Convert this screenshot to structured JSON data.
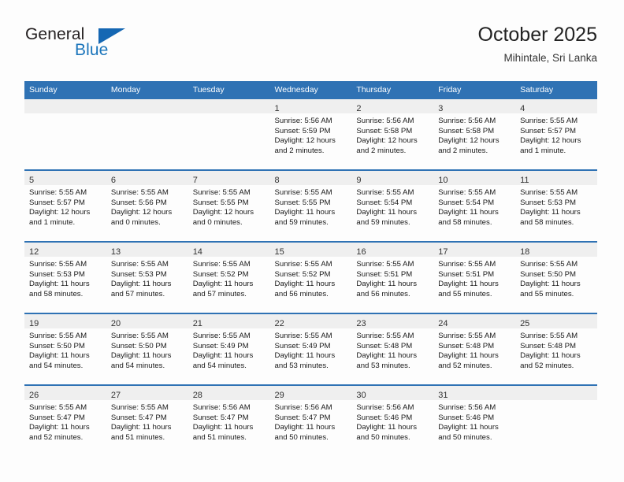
{
  "brand": {
    "name_part1": "General",
    "name_part2": "Blue",
    "accent_color": "#1b75bb",
    "triangle_color": "#1567b3"
  },
  "header": {
    "title": "October 2025",
    "subtitle": "Mihintale, Sri Lanka"
  },
  "calendar": {
    "header_bg": "#2f72b4",
    "daynum_bg": "#efefef",
    "weekdays": [
      "Sunday",
      "Monday",
      "Tuesday",
      "Wednesday",
      "Thursday",
      "Friday",
      "Saturday"
    ],
    "weeks": [
      [
        {
          "day": "",
          "empty": true
        },
        {
          "day": "",
          "empty": true
        },
        {
          "day": "",
          "empty": true
        },
        {
          "day": "1",
          "sunrise": "Sunrise: 5:56 AM",
          "sunset": "Sunset: 5:59 PM",
          "daylight1": "Daylight: 12 hours",
          "daylight2": "and 2 minutes."
        },
        {
          "day": "2",
          "sunrise": "Sunrise: 5:56 AM",
          "sunset": "Sunset: 5:58 PM",
          "daylight1": "Daylight: 12 hours",
          "daylight2": "and 2 minutes."
        },
        {
          "day": "3",
          "sunrise": "Sunrise: 5:56 AM",
          "sunset": "Sunset: 5:58 PM",
          "daylight1": "Daylight: 12 hours",
          "daylight2": "and 2 minutes."
        },
        {
          "day": "4",
          "sunrise": "Sunrise: 5:55 AM",
          "sunset": "Sunset: 5:57 PM",
          "daylight1": "Daylight: 12 hours",
          "daylight2": "and 1 minute."
        }
      ],
      [
        {
          "day": "5",
          "sunrise": "Sunrise: 5:55 AM",
          "sunset": "Sunset: 5:57 PM",
          "daylight1": "Daylight: 12 hours",
          "daylight2": "and 1 minute."
        },
        {
          "day": "6",
          "sunrise": "Sunrise: 5:55 AM",
          "sunset": "Sunset: 5:56 PM",
          "daylight1": "Daylight: 12 hours",
          "daylight2": "and 0 minutes."
        },
        {
          "day": "7",
          "sunrise": "Sunrise: 5:55 AM",
          "sunset": "Sunset: 5:55 PM",
          "daylight1": "Daylight: 12 hours",
          "daylight2": "and 0 minutes."
        },
        {
          "day": "8",
          "sunrise": "Sunrise: 5:55 AM",
          "sunset": "Sunset: 5:55 PM",
          "daylight1": "Daylight: 11 hours",
          "daylight2": "and 59 minutes."
        },
        {
          "day": "9",
          "sunrise": "Sunrise: 5:55 AM",
          "sunset": "Sunset: 5:54 PM",
          "daylight1": "Daylight: 11 hours",
          "daylight2": "and 59 minutes."
        },
        {
          "day": "10",
          "sunrise": "Sunrise: 5:55 AM",
          "sunset": "Sunset: 5:54 PM",
          "daylight1": "Daylight: 11 hours",
          "daylight2": "and 58 minutes."
        },
        {
          "day": "11",
          "sunrise": "Sunrise: 5:55 AM",
          "sunset": "Sunset: 5:53 PM",
          "daylight1": "Daylight: 11 hours",
          "daylight2": "and 58 minutes."
        }
      ],
      [
        {
          "day": "12",
          "sunrise": "Sunrise: 5:55 AM",
          "sunset": "Sunset: 5:53 PM",
          "daylight1": "Daylight: 11 hours",
          "daylight2": "and 58 minutes."
        },
        {
          "day": "13",
          "sunrise": "Sunrise: 5:55 AM",
          "sunset": "Sunset: 5:53 PM",
          "daylight1": "Daylight: 11 hours",
          "daylight2": "and 57 minutes."
        },
        {
          "day": "14",
          "sunrise": "Sunrise: 5:55 AM",
          "sunset": "Sunset: 5:52 PM",
          "daylight1": "Daylight: 11 hours",
          "daylight2": "and 57 minutes."
        },
        {
          "day": "15",
          "sunrise": "Sunrise: 5:55 AM",
          "sunset": "Sunset: 5:52 PM",
          "daylight1": "Daylight: 11 hours",
          "daylight2": "and 56 minutes."
        },
        {
          "day": "16",
          "sunrise": "Sunrise: 5:55 AM",
          "sunset": "Sunset: 5:51 PM",
          "daylight1": "Daylight: 11 hours",
          "daylight2": "and 56 minutes."
        },
        {
          "day": "17",
          "sunrise": "Sunrise: 5:55 AM",
          "sunset": "Sunset: 5:51 PM",
          "daylight1": "Daylight: 11 hours",
          "daylight2": "and 55 minutes."
        },
        {
          "day": "18",
          "sunrise": "Sunrise: 5:55 AM",
          "sunset": "Sunset: 5:50 PM",
          "daylight1": "Daylight: 11 hours",
          "daylight2": "and 55 minutes."
        }
      ],
      [
        {
          "day": "19",
          "sunrise": "Sunrise: 5:55 AM",
          "sunset": "Sunset: 5:50 PM",
          "daylight1": "Daylight: 11 hours",
          "daylight2": "and 54 minutes."
        },
        {
          "day": "20",
          "sunrise": "Sunrise: 5:55 AM",
          "sunset": "Sunset: 5:50 PM",
          "daylight1": "Daylight: 11 hours",
          "daylight2": "and 54 minutes."
        },
        {
          "day": "21",
          "sunrise": "Sunrise: 5:55 AM",
          "sunset": "Sunset: 5:49 PM",
          "daylight1": "Daylight: 11 hours",
          "daylight2": "and 54 minutes."
        },
        {
          "day": "22",
          "sunrise": "Sunrise: 5:55 AM",
          "sunset": "Sunset: 5:49 PM",
          "daylight1": "Daylight: 11 hours",
          "daylight2": "and 53 minutes."
        },
        {
          "day": "23",
          "sunrise": "Sunrise: 5:55 AM",
          "sunset": "Sunset: 5:48 PM",
          "daylight1": "Daylight: 11 hours",
          "daylight2": "and 53 minutes."
        },
        {
          "day": "24",
          "sunrise": "Sunrise: 5:55 AM",
          "sunset": "Sunset: 5:48 PM",
          "daylight1": "Daylight: 11 hours",
          "daylight2": "and 52 minutes."
        },
        {
          "day": "25",
          "sunrise": "Sunrise: 5:55 AM",
          "sunset": "Sunset: 5:48 PM",
          "daylight1": "Daylight: 11 hours",
          "daylight2": "and 52 minutes."
        }
      ],
      [
        {
          "day": "26",
          "sunrise": "Sunrise: 5:55 AM",
          "sunset": "Sunset: 5:47 PM",
          "daylight1": "Daylight: 11 hours",
          "daylight2": "and 52 minutes."
        },
        {
          "day": "27",
          "sunrise": "Sunrise: 5:55 AM",
          "sunset": "Sunset: 5:47 PM",
          "daylight1": "Daylight: 11 hours",
          "daylight2": "and 51 minutes."
        },
        {
          "day": "28",
          "sunrise": "Sunrise: 5:56 AM",
          "sunset": "Sunset: 5:47 PM",
          "daylight1": "Daylight: 11 hours",
          "daylight2": "and 51 minutes."
        },
        {
          "day": "29",
          "sunrise": "Sunrise: 5:56 AM",
          "sunset": "Sunset: 5:47 PM",
          "daylight1": "Daylight: 11 hours",
          "daylight2": "and 50 minutes."
        },
        {
          "day": "30",
          "sunrise": "Sunrise: 5:56 AM",
          "sunset": "Sunset: 5:46 PM",
          "daylight1": "Daylight: 11 hours",
          "daylight2": "and 50 minutes."
        },
        {
          "day": "31",
          "sunrise": "Sunrise: 5:56 AM",
          "sunset": "Sunset: 5:46 PM",
          "daylight1": "Daylight: 11 hours",
          "daylight2": "and 50 minutes."
        },
        {
          "day": "",
          "empty": true
        }
      ]
    ]
  }
}
